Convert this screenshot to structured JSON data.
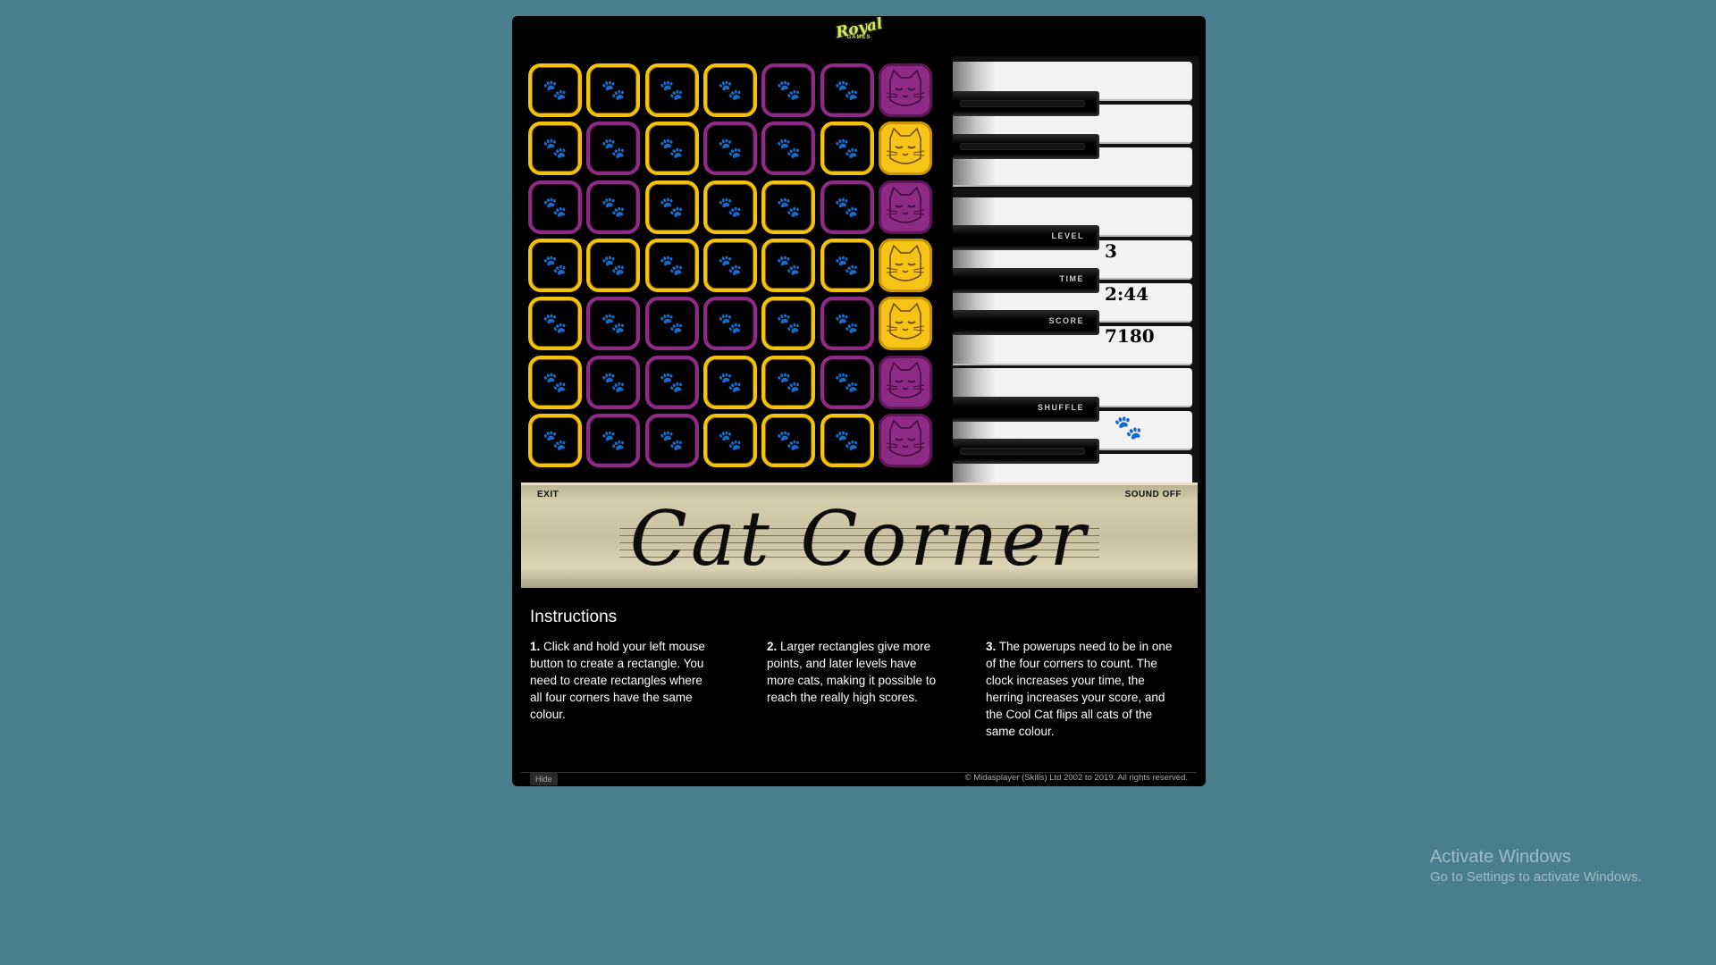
{
  "logo": {
    "main": "Royal",
    "sub": "GAMES"
  },
  "board": {
    "rows": [
      [
        "y",
        "y",
        "y",
        "y",
        "p",
        "p",
        "cat-p"
      ],
      [
        "y",
        "p",
        "y",
        "p",
        "p",
        "y",
        "cat-y"
      ],
      [
        "p",
        "p",
        "y",
        "y",
        "y",
        "p",
        "cat-p"
      ],
      [
        "y",
        "y",
        "y",
        "y",
        "y",
        "y",
        "cat-y"
      ],
      [
        "y",
        "p",
        "p",
        "p",
        "y",
        "p",
        "cat-y"
      ],
      [
        "y",
        "p",
        "p",
        "y",
        "y",
        "p",
        "cat-p"
      ],
      [
        "y",
        "p",
        "p",
        "y",
        "y",
        "y",
        "cat-p"
      ]
    ],
    "colors": {
      "yellow": "#f2c20c",
      "purple": "#8e2b86"
    },
    "tile_icon": "paw-icon"
  },
  "stats": {
    "level_label": "LEVEL",
    "level_value": "3",
    "time_label": "TIME",
    "time_value": "2:44",
    "score_label": "SCORE",
    "score_value": "7180",
    "shuffle_label": "SHUFFLE"
  },
  "banner": {
    "exit": "EXIT",
    "sound": "SOUND OFF",
    "title": "Cat Corner"
  },
  "instructions": {
    "title": "Instructions",
    "items": [
      {
        "num": "1.",
        "text": " Click and hold your left mouse button to create a rectangle. You need to create rectangles where all four corners have the same colour."
      },
      {
        "num": "2.",
        "text": " Larger rectangles give more points, and later levels have more cats, making it possible to reach the really high scores."
      },
      {
        "num": "3.",
        "text": " The powerups need to be in one of the four corners to count. The clock increases your time, the herring increases your score, and the Cool Cat flips all cats of the same colour."
      }
    ]
  },
  "footer": {
    "hide": "Hide",
    "copyright": "© Midasplayer (Skills) Ltd 2002 to 2019. All rights reserved."
  },
  "watermark": {
    "title": "Activate Windows",
    "subtitle": "Go to Settings to activate Windows."
  }
}
